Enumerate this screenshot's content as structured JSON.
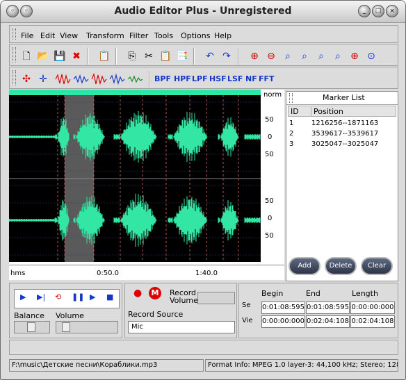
{
  "window": {
    "title": "Audio Editor Plus - Unregistered"
  },
  "menu": [
    "File",
    "Edit",
    "View",
    "Transform",
    "Filter",
    "Tools",
    "Options",
    "Help"
  ],
  "toolbar": {
    "icons": [
      "new-file-icon",
      "open-file-icon",
      "save-icon",
      "delete-icon",
      "properties-icon",
      "copy-icon",
      "cut-icon",
      "paste-icon",
      "paste-mix-icon",
      "undo-icon",
      "redo-icon",
      "zoom-in-icon",
      "zoom-out-icon",
      "zoom-selection-icon",
      "zoom-full-icon",
      "zoom-vertical-in-icon",
      "zoom-vertical-out-icon",
      "zoom-fit-icon",
      "zoom-reset-icon"
    ]
  },
  "effects": {
    "filters": [
      "BPF",
      "HPF",
      "LPF",
      "HSF",
      "LSF",
      "NF",
      "FFT"
    ]
  },
  "waveform": {
    "scale_labels": [
      "norm",
      "50",
      "0",
      "50",
      "50",
      "0",
      "50"
    ],
    "time_unit": "hms",
    "time_labels": [
      "0:50.0",
      "1:40.0"
    ]
  },
  "markers": {
    "title": "Marker List",
    "columns": [
      "ID",
      "Position"
    ],
    "rows": [
      {
        "id": "1",
        "position": "1216256--1871163"
      },
      {
        "id": "2",
        "position": "3539617--3539617"
      },
      {
        "id": "3",
        "position": "3025047--3025047"
      }
    ],
    "add": "Add",
    "delete": "Delete",
    "clear": "Clear"
  },
  "transport": {
    "balance": "Balance",
    "volume": "Volume"
  },
  "record": {
    "record_volume": "Record Volume",
    "record_source": "Record Source",
    "source_value": "Mic"
  },
  "selection": {
    "labels": {
      "sel": "Se",
      "view": "Vie"
    },
    "headers": [
      "Begin",
      "End",
      "Length"
    ],
    "sel_values": [
      "0:01:08:595",
      "0:01:08:595",
      "0:00:00:000"
    ],
    "view_values": [
      "0:00:00:000",
      "0:02:04:108",
      "0:02:04:108"
    ]
  },
  "status": {
    "file": "F:\\music\\Детские  песни\\Кораблики.mp3",
    "format": "Format Info: MPEG 1.0 layer-3: 44,100 kHz; Stereo; 128"
  },
  "colors": {
    "wave": "#33e6a4",
    "wave_bg": "#000000",
    "accent": "#1438c8"
  }
}
